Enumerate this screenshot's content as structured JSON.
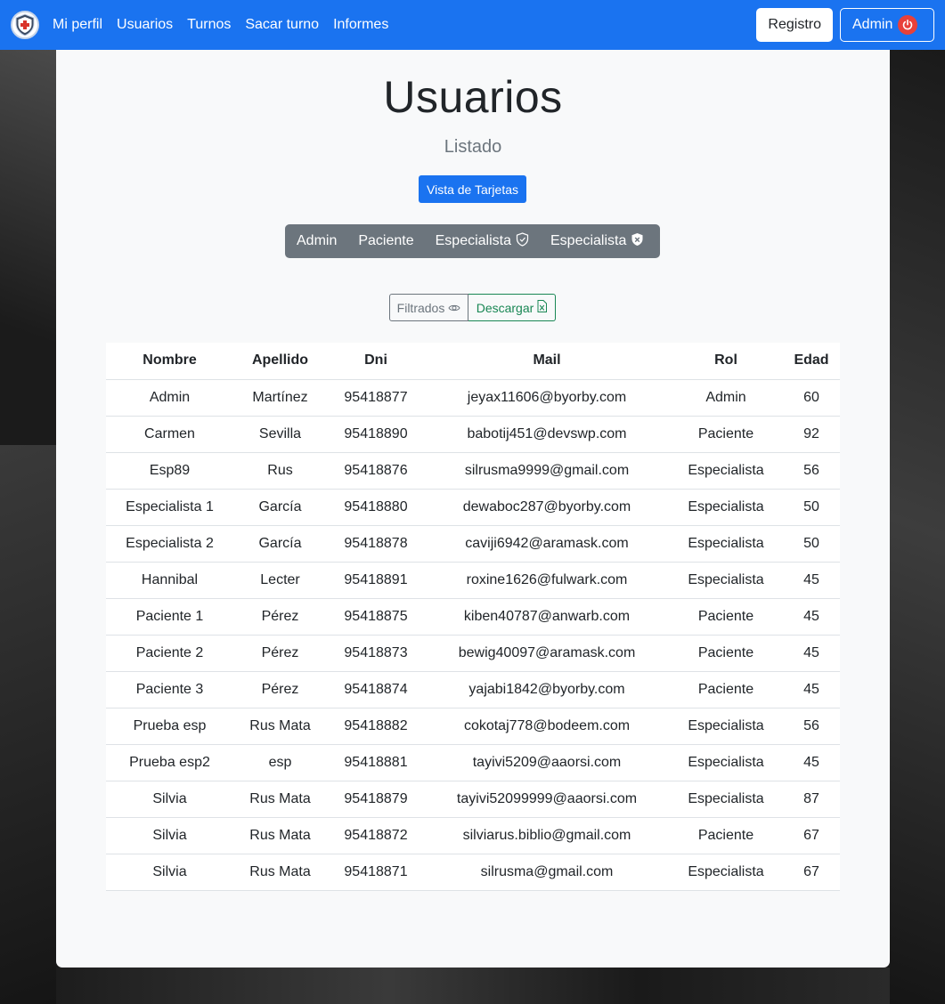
{
  "nav": {
    "links": [
      "Mi perfil",
      "Usuarios",
      "Turnos",
      "Sacar turno",
      "Informes"
    ],
    "registro_label": "Registro",
    "admin_label": "Admin"
  },
  "page": {
    "title": "Usuarios",
    "subtitle": "Listado",
    "cards_button": "Vista de Tarjetas",
    "filters": [
      "Admin",
      "Paciente",
      "Especialista",
      "Especialista"
    ],
    "filtrados_label": "Filtrados",
    "descargar_label": "Descargar"
  },
  "table": {
    "headers": [
      "Nombre",
      "Apellido",
      "Dni",
      "Mail",
      "Rol",
      "Edad"
    ],
    "rows": [
      [
        "Admin",
        "Martínez",
        "95418877",
        "jeyax11606@byorby.com",
        "Admin",
        "60"
      ],
      [
        "Carmen",
        "Sevilla",
        "95418890",
        "babotij451@devswp.com",
        "Paciente",
        "92"
      ],
      [
        "Esp89",
        "Rus",
        "95418876",
        "silrusma9999@gmail.com",
        "Especialista",
        "56"
      ],
      [
        "Especialista 1",
        "García",
        "95418880",
        "dewaboc287@byorby.com",
        "Especialista",
        "50"
      ],
      [
        "Especialista 2",
        "García",
        "95418878",
        "caviji6942@aramask.com",
        "Especialista",
        "50"
      ],
      [
        "Hannibal",
        "Lecter",
        "95418891",
        "roxine1626@fulwark.com",
        "Especialista",
        "45"
      ],
      [
        "Paciente 1",
        "Pérez",
        "95418875",
        "kiben40787@anwarb.com",
        "Paciente",
        "45"
      ],
      [
        "Paciente 2",
        "Pérez",
        "95418873",
        "bewig40097@aramask.com",
        "Paciente",
        "45"
      ],
      [
        "Paciente 3",
        "Pérez",
        "95418874",
        "yajabi1842@byorby.com",
        "Paciente",
        "45"
      ],
      [
        "Prueba esp",
        "Rus Mata",
        "95418882",
        "cokotaj778@bodeem.com",
        "Especialista",
        "56"
      ],
      [
        "Prueba esp2",
        "esp",
        "95418881",
        "tayivi5209@aaorsi.com",
        "Especialista",
        "45"
      ],
      [
        "Silvia",
        "Rus Mata",
        "95418879",
        "tayivi52099999@aaorsi.com",
        "Especialista",
        "87"
      ],
      [
        "Silvia",
        "Rus Mata",
        "95418872",
        "silviarus.biblio@gmail.com",
        "Paciente",
        "67"
      ],
      [
        "Silvia",
        "Rus Mata",
        "95418871",
        "silrusma@gmail.com",
        "Especialista",
        "67"
      ]
    ]
  },
  "colors": {
    "primary": "#1a73f0",
    "secondary": "#6c757d",
    "success": "#198754",
    "danger": "#e8413a"
  },
  "icons": {
    "logo": "medical-shield-logo",
    "power": "power-icon",
    "shield_outline": "shield-check-outline-icon",
    "shield_filled": "shield-filled-icon",
    "eye": "eye-icon",
    "excel": "file-excel-icon"
  }
}
